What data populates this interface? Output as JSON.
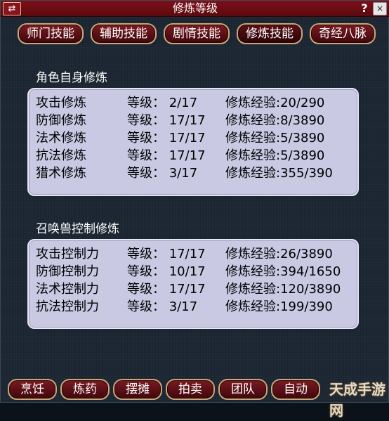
{
  "window": {
    "title": "修炼等级",
    "left_icon": "⇄",
    "left_icon_name": "switch-icon",
    "help_icon": "?",
    "close_icon": "×"
  },
  "tabs": [
    {
      "label": "师门技能"
    },
    {
      "label": "辅助技能"
    },
    {
      "label": "剧情技能"
    },
    {
      "label": "修炼技能",
      "active": true
    },
    {
      "label": "奇经八脉"
    }
  ],
  "character": {
    "title": "角色自身修炼",
    "rows": [
      {
        "name": "攻击修炼",
        "level": "等级：  2/17",
        "exp": "修炼经验:20/290"
      },
      {
        "name": "防御修炼",
        "level": "等级： 17/17",
        "exp": "修炼经验:8/3890"
      },
      {
        "name": "法术修炼",
        "level": "等级： 17/17",
        "exp": "修炼经验:5/3890"
      },
      {
        "name": "抗法修炼",
        "level": "等级： 17/17",
        "exp": "修炼经验:5/3890"
      },
      {
        "name": "猎术修炼",
        "level": "等级：  3/17",
        "exp": "修炼经验:355/390"
      }
    ]
  },
  "pet": {
    "title": "召唤兽控制修炼",
    "rows": [
      {
        "name": "攻击控制力",
        "level": "等级： 17/17",
        "exp": "修炼经验:26/3890"
      },
      {
        "name": "防御控制力",
        "level": "等级： 10/17",
        "exp": "修炼经验:394/1650"
      },
      {
        "name": "法术控制力",
        "level": "等级： 17/17",
        "exp": "修炼经验:120/3890"
      },
      {
        "name": "抗法控制力",
        "level": "等级：  3/17",
        "exp": "修炼经验:199/390"
      }
    ]
  },
  "bottom_bar": [
    {
      "label": "烹饪"
    },
    {
      "label": "炼药"
    },
    {
      "label": "摆摊"
    },
    {
      "label": "拍卖"
    },
    {
      "label": "团队"
    },
    {
      "label": "自动"
    }
  ],
  "watermark": "天成手游网",
  "colors": {
    "title_bar": "#7e1018",
    "window_bg": "#1c2733",
    "panel_bg": "#c9c9e4",
    "button_border": "#c8a878"
  }
}
